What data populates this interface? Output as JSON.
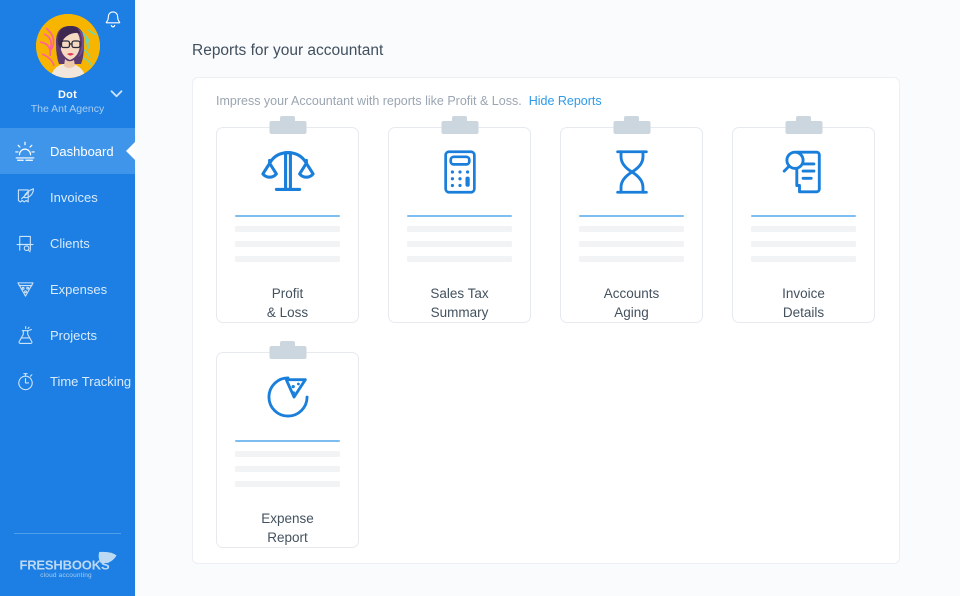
{
  "sidebar": {
    "profile": {
      "name": "Dot",
      "org": "The Ant Agency",
      "avatar_icon": "user-avatar",
      "bell_icon": "bell-icon",
      "chevron_icon": "chevron-down-icon"
    },
    "items": [
      {
        "label": "Dashboard",
        "icon": "dashboard-sunrise-icon",
        "active": true
      },
      {
        "label": "Invoices",
        "icon": "invoice-quill-icon",
        "active": false
      },
      {
        "label": "Clients",
        "icon": "clients-desk-icon",
        "active": false
      },
      {
        "label": "Expenses",
        "icon": "expenses-pizza-icon",
        "active": false
      },
      {
        "label": "Projects",
        "icon": "projects-flask-icon",
        "active": false
      },
      {
        "label": "Time Tracking",
        "icon": "stopwatch-icon",
        "active": false
      }
    ],
    "brand": {
      "name": "FreshBooks",
      "tagline": "cloud accounting"
    }
  },
  "main": {
    "title": "Reports for your accountant",
    "panel": {
      "note": "Impress your Accountant with reports like Profit & Loss.",
      "hide_label": "Hide Reports",
      "cards": [
        {
          "line1": "Profit",
          "line2": "& Loss",
          "icon": "scales-icon"
        },
        {
          "line1": "Sales Tax",
          "line2": "Summary",
          "icon": "calculator-icon"
        },
        {
          "line1": "Accounts",
          "line2": "Aging",
          "icon": "hourglass-icon"
        },
        {
          "line1": "Invoice",
          "line2": "Details",
          "icon": "invoice-search-icon"
        },
        {
          "line1": "Expense",
          "line2": "Report",
          "icon": "pie-chart-icon"
        }
      ]
    }
  },
  "colors": {
    "sidebar_blue": "#1d7fe3",
    "sidebar_active": "#3f95ea",
    "accent_blue": "#2f9ae8",
    "icon_blue": "#1a7fdb",
    "page_bg": "#fafbfd",
    "text_dark": "#41505e"
  }
}
